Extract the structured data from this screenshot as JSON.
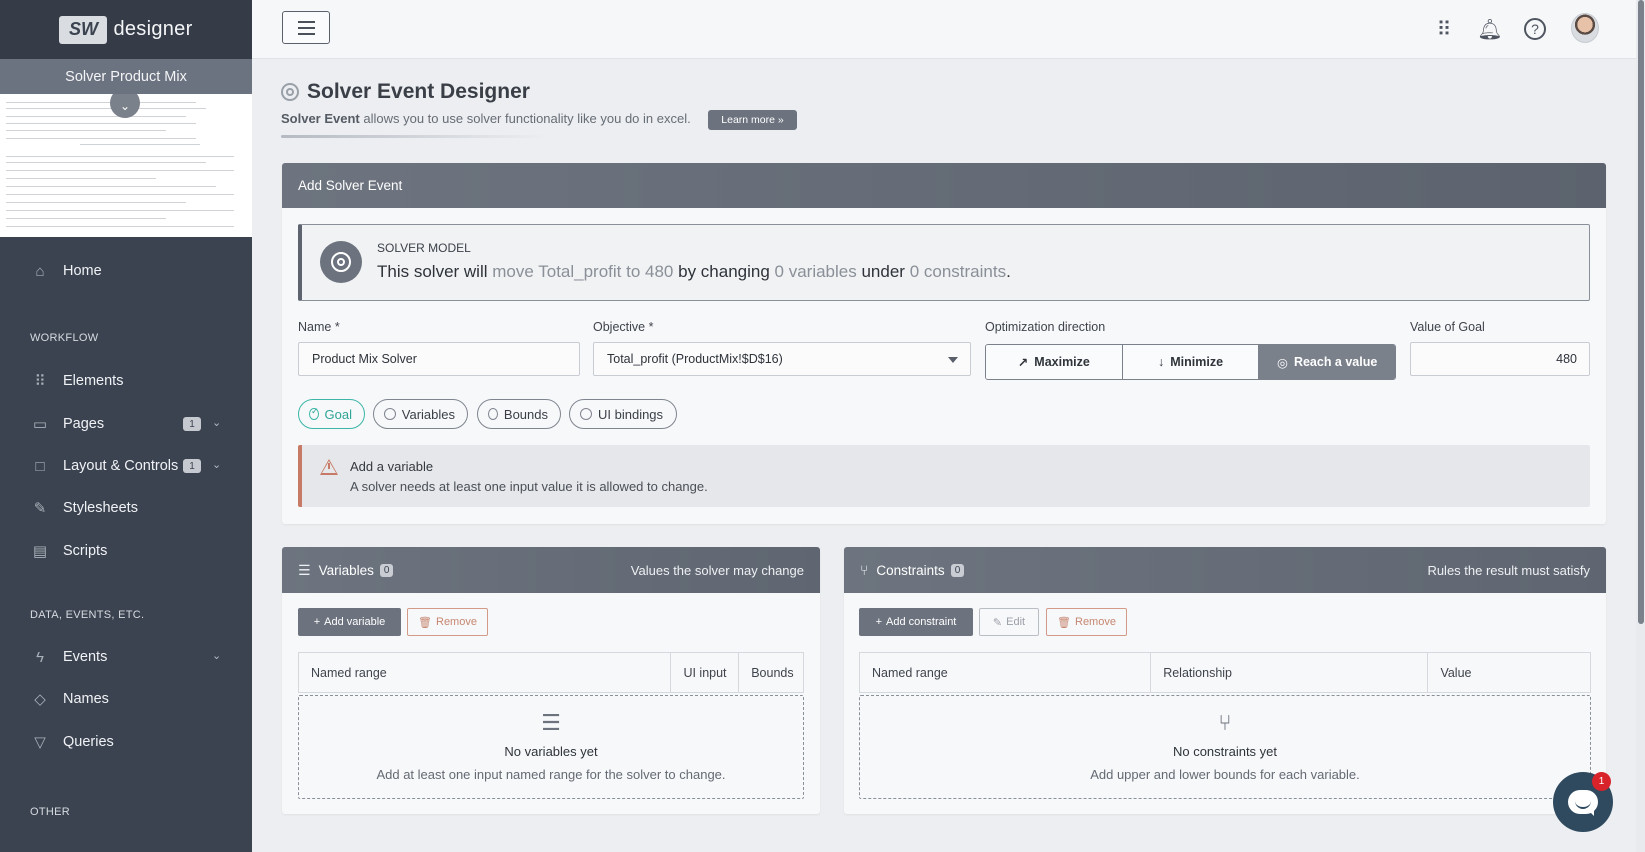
{
  "brand": {
    "logo_mark": "SW",
    "logo_text": "designer"
  },
  "sidebar": {
    "project": "Solver Product Mix",
    "items": [
      {
        "label": "Home",
        "icon": "home-icon"
      },
      {
        "label": "Elements",
        "icon": "grid-icon"
      },
      {
        "label": "Pages",
        "icon": "book-icon",
        "badge": "1"
      },
      {
        "label": "Layout & Controls",
        "icon": "window-icon",
        "badge": "1"
      },
      {
        "label": "Stylesheets",
        "icon": "brush-icon"
      },
      {
        "label": "Scripts",
        "icon": "code-icon"
      },
      {
        "label": "Events",
        "icon": "lightning-icon"
      },
      {
        "label": "Names",
        "icon": "tag-icon"
      },
      {
        "label": "Queries",
        "icon": "filter-icon"
      }
    ],
    "sections": {
      "workflow": "WORKFLOW",
      "data": "DATA, EVENTS, ETC.",
      "other": "OTHER"
    }
  },
  "header": {
    "title": "Solver Event Designer",
    "subtitle_bold": "Solver Event",
    "subtitle_rest": " allows you to use solver functionality like you do in excel.",
    "learn_more": "Learn more »"
  },
  "form": {
    "card_title": "Add Solver Event",
    "model": {
      "label": "SOLVER MODEL",
      "s1": "This solver will ",
      "s2": "move Total_profit to 480",
      "s3": " by changing ",
      "s4": "0 variables",
      "s5": " under ",
      "s6": "0 constraints",
      "s7": "."
    },
    "name_label": "Name *",
    "name_value": "Product Mix Solver",
    "objective_label": "Objective *",
    "objective_value": "Total_profit (ProductMix!$D$16)",
    "direction_label": "Optimization direction",
    "direction_options": [
      "Maximize",
      "Minimize",
      "Reach a value"
    ],
    "direction_selected": "Reach a value",
    "goal_label": "Value of Goal",
    "goal_value": "480",
    "tabs": [
      "Goal",
      "Variables",
      "Bounds",
      "UI bindings"
    ],
    "active_tab": "Goal",
    "alert_title": "Add a variable",
    "alert_text": "A solver needs at least one input value it is allowed to change."
  },
  "variables_panel": {
    "title": "Variables",
    "count": "0",
    "hint": "Values the solver may change",
    "add": "Add variable",
    "remove": "Remove",
    "columns": [
      "Named range",
      "UI input",
      "Bounds"
    ],
    "empty_title": "No variables yet",
    "empty_text": "Add at least one input named range for the solver to change."
  },
  "constraints_panel": {
    "title": "Constraints",
    "count": "0",
    "hint": "Rules the result must satisfy",
    "add": "Add constraint",
    "edit": "Edit",
    "remove": "Remove",
    "columns": [
      "Named range",
      "Relationship",
      "Value"
    ],
    "empty_title": "No constraints yet",
    "empty_text": "Add upper and lower bounds for each variable."
  },
  "chat": {
    "badge": "1"
  },
  "colors": {
    "accent": "#3bb6a7",
    "sidebar": "#3b4350",
    "panel_header": "#6d747f",
    "warning": "#c77b66",
    "danger": "#d9232b"
  }
}
